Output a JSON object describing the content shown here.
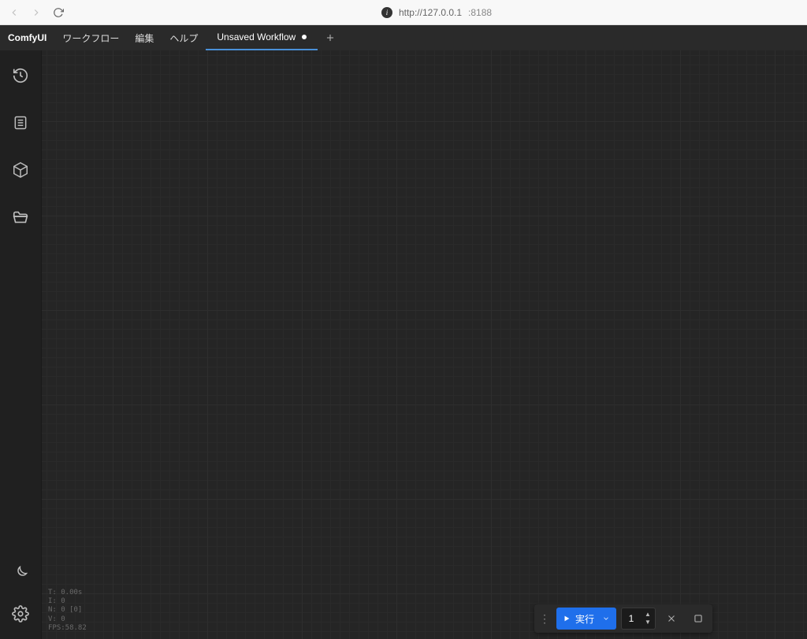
{
  "browser": {
    "url_host": "http://127.0.0.1",
    "url_port": ":8188"
  },
  "menubar": {
    "brand": "ComfyUI",
    "items": [
      "ワークフロー",
      "編集",
      "ヘルプ"
    ]
  },
  "tab": {
    "title": "Unsaved Workflow"
  },
  "rail_icons": {
    "top": [
      {
        "name": "history-icon"
      },
      {
        "name": "queue-icon"
      },
      {
        "name": "nodes-icon"
      },
      {
        "name": "folder-icon"
      }
    ],
    "bottom": [
      {
        "name": "theme-icon"
      },
      {
        "name": "settings-icon"
      }
    ]
  },
  "debug": {
    "t": "T: 0.00s",
    "i": "I: 0",
    "n": "N: 0 [0]",
    "v": "V: 0",
    "fps": "FPS:58.82"
  },
  "exec": {
    "run_label": "実行",
    "count": "1"
  }
}
